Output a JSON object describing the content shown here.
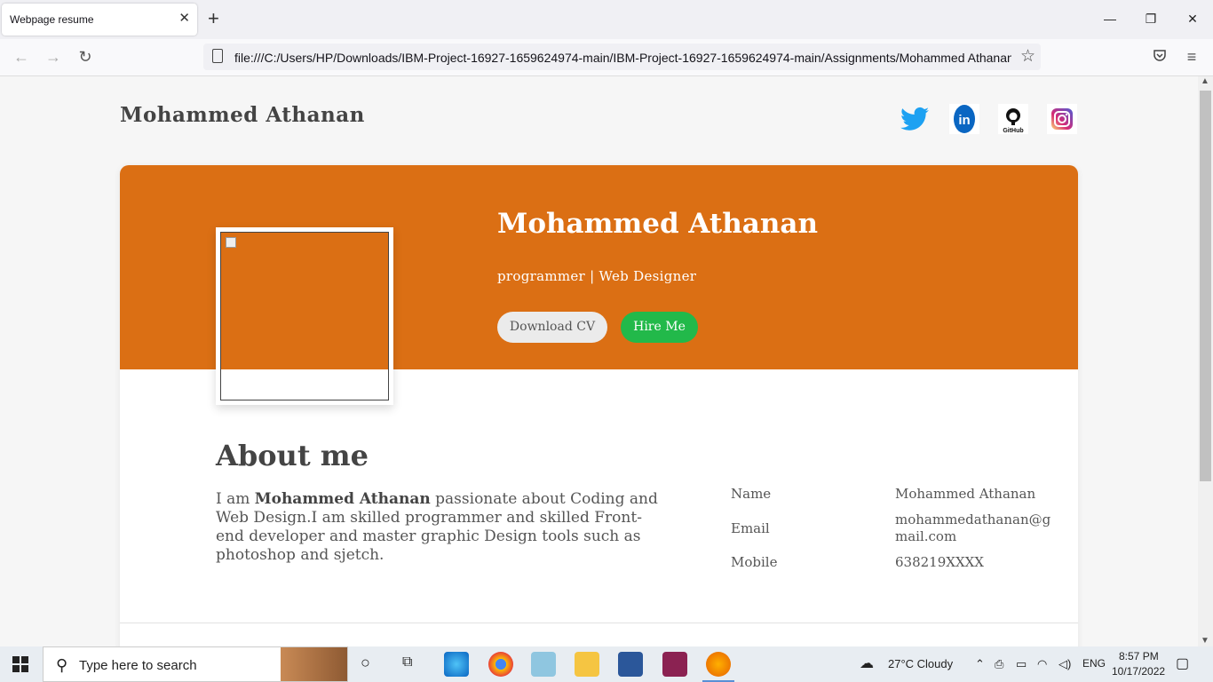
{
  "browser": {
    "tab_title": "Webpage resume",
    "url": "file:///C:/Users/HP/Downloads/IBM-Project-16927-1659624974-main/IBM-Project-16927-1659624974-main/Assignments/Mohammed Athanan"
  },
  "page": {
    "site_name": "Mohammed Athanan",
    "social": [
      "twitter-icon",
      "linkedin-icon",
      "github-icon",
      "instagram-icon"
    ],
    "hero": {
      "name": "Mohammed Athanan",
      "role": "programmer | Web Designer",
      "download_cv": "Download CV",
      "hire_me": "Hire Me"
    },
    "about": {
      "title": "About me",
      "text_prefix": "I am ",
      "text_name": "Mohammed Athanan",
      "text_body": " passionate about Coding and Web Design.I am skilled programmer and skilled Front-end developer and master graphic Design tools such as photoshop and sjetch."
    },
    "info": {
      "name_label": "Name",
      "name_value": "Mohammed Athanan",
      "email_label": "Email",
      "email_value": "mohammedathanan@gmail.com",
      "mobile_label": "Mobile",
      "mobile_value": "638219XXXX"
    },
    "colors": {
      "accent": "#db6f14",
      "hire_button": "#22b94a"
    }
  },
  "taskbar": {
    "search_placeholder": "Type here to search",
    "weather": "27°C  Cloudy",
    "language": "ENG",
    "time": "8:57 PM",
    "date": "10/17/2022"
  }
}
